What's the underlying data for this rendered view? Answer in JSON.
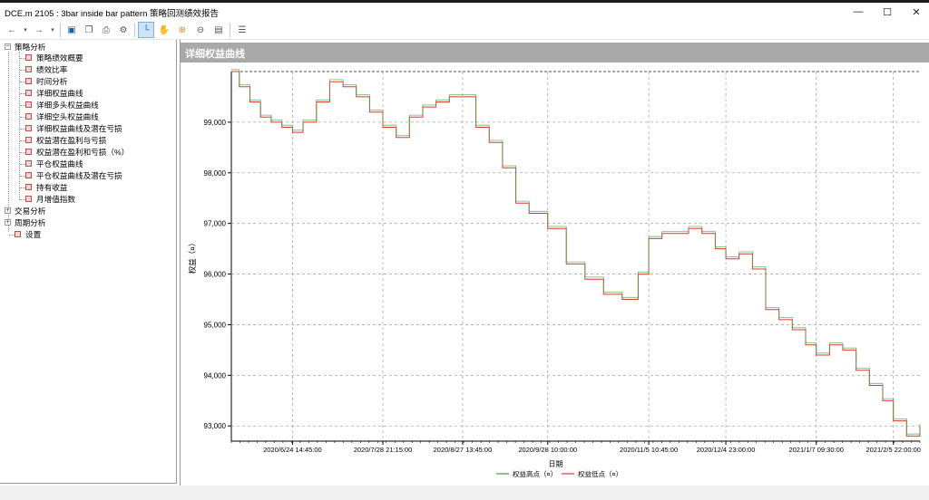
{
  "window": {
    "title": "DCE.m 2105 : 3bar inside bar pattern 策略回测绩效报告"
  },
  "panel": {
    "title": "详细权益曲线"
  },
  "tree": {
    "root": "策略分析",
    "children": [
      "策略绩效概要",
      "绩效比率",
      "时间分析",
      "详细权益曲线",
      "详细多头权益曲线",
      "详细空头权益曲线",
      "详细权益曲线及潜在亏损",
      "权益潜在盈利与亏损",
      "权益潜在盈利和亏损（%）",
      "平仓权益曲线",
      "平仓权益曲线及潜在亏损",
      "持有收益",
      "月增值指数"
    ],
    "siblings": [
      "交易分析",
      "周期分析",
      "设置"
    ]
  },
  "toolbar": {
    "icons": [
      "back-icon",
      "forward-icon",
      "save-icon",
      "copy-icon",
      "print-icon",
      "settings-icon",
      "cursor-icon",
      "hand-icon",
      "zoom-in-icon",
      "zoom-out-icon",
      "fit-icon",
      "chart-icon"
    ]
  },
  "chart_data": {
    "type": "line",
    "ylabel": "权益（¤）",
    "xlabel": "日期",
    "ylim": [
      92700,
      100000
    ],
    "yticks": [
      "93,000",
      "94,000",
      "95,000",
      "96,000",
      "97,000",
      "98,000",
      "99,000"
    ],
    "xticks": [
      "2020/6/24 14:45:00",
      "2020/7/28 21:15:00",
      "2020/8/27 13:45:00",
      "2020/9/28 10:00:00",
      "2020/11/5 10:45:00",
      "2020/12/4 23:00:00",
      "2021/1/7 09:30:00",
      "2021/2/5 22:00:00"
    ],
    "series": [
      {
        "name": "权益高点（¤）",
        "color": "#3aa04a"
      },
      {
        "name": "权益低点（¤）",
        "color": "#e0372d"
      }
    ],
    "x": [
      "2020/6/1",
      "2020/6/4",
      "2020/6/8",
      "2020/6/12",
      "2020/6/16",
      "2020/6/20",
      "2020/6/24",
      "2020/6/28",
      "2020/7/3",
      "2020/7/8",
      "2020/7/13",
      "2020/7/18",
      "2020/7/23",
      "2020/7/28",
      "2020/8/2",
      "2020/8/7",
      "2020/8/12",
      "2020/8/17",
      "2020/8/22",
      "2020/8/27",
      "2020/9/1",
      "2020/9/6",
      "2020/9/11",
      "2020/9/16",
      "2020/9/21",
      "2020/9/28",
      "2020/10/5",
      "2020/10/12",
      "2020/10/19",
      "2020/10/26",
      "2020/11/1",
      "2020/11/5",
      "2020/11/10",
      "2020/11/15",
      "2020/11/20",
      "2020/11/25",
      "2020/11/30",
      "2020/12/4",
      "2020/12/9",
      "2020/12/14",
      "2020/12/19",
      "2020/12/24",
      "2020/12/29",
      "2021/1/3",
      "2021/1/7",
      "2021/1/12",
      "2021/1/17",
      "2021/1/22",
      "2021/1/27",
      "2021/2/1",
      "2021/2/5",
      "2021/2/10",
      "2021/2/15"
    ],
    "values": [
      100000,
      99700,
      99400,
      99100,
      99000,
      98900,
      98800,
      99000,
      99400,
      99800,
      99700,
      99500,
      99200,
      98900,
      98700,
      99100,
      99300,
      99400,
      99500,
      99500,
      98900,
      98600,
      98100,
      97400,
      97200,
      96900,
      96200,
      95900,
      95600,
      95500,
      96000,
      96700,
      96800,
      96800,
      96900,
      96800,
      96500,
      96300,
      96400,
      96100,
      95300,
      95100,
      94900,
      94600,
      94400,
      94600,
      94500,
      94100,
      93800,
      93500,
      93100,
      92800,
      93000
    ]
  }
}
